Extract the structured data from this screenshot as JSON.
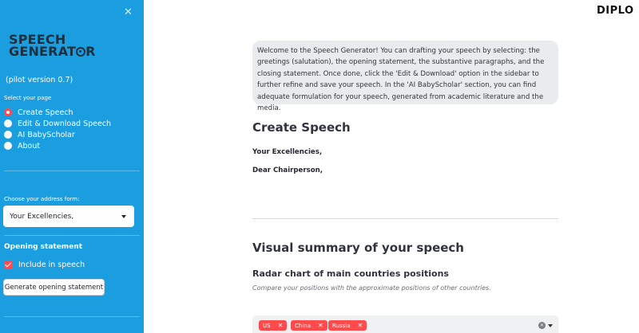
{
  "sidebar": {
    "close_icon": "close-icon",
    "logo": {
      "line1": "SPEECH",
      "line2_pre": "GENERAT",
      "line2_post": "R"
    },
    "pilot_version": "(pilot version 0.7)",
    "select_page_label": "Select your page",
    "pages": [
      {
        "label": "Create Speech",
        "selected": true
      },
      {
        "label": "Edit & Download Speech",
        "selected": false
      },
      {
        "label": "AI BabyScholar",
        "selected": false
      },
      {
        "label": "About",
        "selected": false
      }
    ],
    "address_form_label": "Choose your address form:",
    "address_form_value": "Your Excellencies,",
    "opening_statement_title": "Opening statement",
    "include_in_speech_label": "Include in speech",
    "include_in_speech_checked": true,
    "generate_button_label": "Generate opening statement"
  },
  "header": {
    "brand_logo": "DIPLO"
  },
  "main": {
    "intro_text": "Welcome to the Speech Generator! You can drafting your speech by selecting: the greetings (salutation), the opening statement, the substantive paragraphs, and the closing statement. Once done, click the 'Edit & Download' option in the sidebar to further refine and save your speech. In the 'AI BabyScholar' section, you can find adequate formulation for your speech, generated from academic literature and the media.",
    "create_heading": "Create Speech",
    "greeting_line1": "Your Excellencies,",
    "greeting_line2": "Dear Chairperson,",
    "visual_heading": "Visual summary of your speech",
    "radar_heading": "Radar chart of main countries positions",
    "radar_caption": "Compare your positions with the approximate positions of other countries.",
    "countries": [
      "US",
      "China",
      "Russia"
    ]
  },
  "colors": {
    "sidebar_bg": "#1a9ee0",
    "accent": "#ff4b4b",
    "intro_bg": "#e8ecef"
  }
}
